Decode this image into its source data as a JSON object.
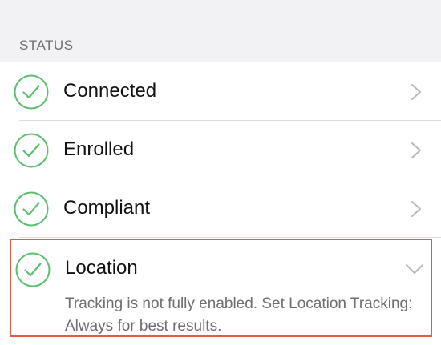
{
  "section": {
    "title": "STATUS"
  },
  "colors": {
    "check": "#5cbf70",
    "chevron": "#b8b8bc",
    "highlight": "#e05a46",
    "detail_text": "#6d6d72"
  },
  "rows": [
    {
      "label": "Connected",
      "icon": "check-circle-icon",
      "state": "collapsed"
    },
    {
      "label": "Enrolled",
      "icon": "check-circle-icon",
      "state": "collapsed"
    },
    {
      "label": "Compliant",
      "icon": "check-circle-icon",
      "state": "collapsed"
    }
  ],
  "location": {
    "label": "Location",
    "icon": "check-circle-icon",
    "state": "expanded",
    "detail": "Tracking is not fully enabled. Set Location Tracking: Always for best results."
  }
}
